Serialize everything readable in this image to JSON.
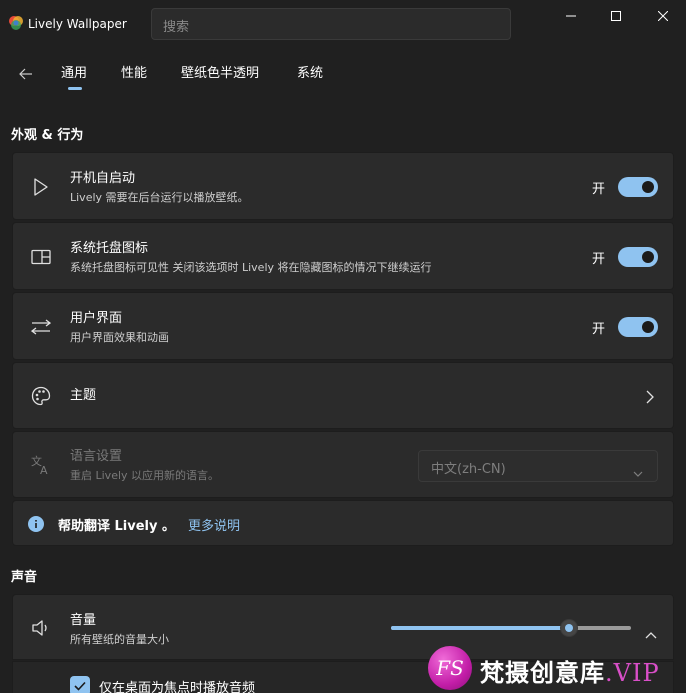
{
  "app": {
    "title": "Lively Wallpaper"
  },
  "search": {
    "placeholder": "搜索"
  },
  "nav": {
    "tabs": [
      {
        "label": "通用"
      },
      {
        "label": "性能"
      },
      {
        "label": "壁纸色半透明"
      },
      {
        "label": "系统"
      }
    ],
    "active_tab": "通用"
  },
  "sections": {
    "appearance": {
      "title": "外观 & 行为",
      "items": [
        {
          "title": "开机自启动",
          "subtitle": "Lively 需要在后台运行以播放壁纸。",
          "toggle_label": "开",
          "state": true,
          "icon": "play-icon"
        },
        {
          "title": "系统托盘图标",
          "subtitle": "系统托盘图标可见性 关闭该选项时 Lively 将在隐藏图标的情况下继续运行",
          "toggle_label": "开",
          "state": true,
          "icon": "tray-icon"
        },
        {
          "title": "用户界面",
          "subtitle": "用户界面效果和动画",
          "toggle_label": "开",
          "state": true,
          "icon": "swap-arrows-icon"
        },
        {
          "title": "主题",
          "icon": "palette-icon"
        },
        {
          "title": "语言设置",
          "subtitle": "重启 Lively 以应用新的语言。",
          "selected": "中文(zh-CN)",
          "icon": "language-icon",
          "disabled": true
        }
      ],
      "info": {
        "text": "帮助翻译 Lively 。",
        "link": "更多说明"
      }
    },
    "sound": {
      "title": "声音",
      "volume": {
        "title": "音量",
        "subtitle": "所有壁纸的音量大小",
        "value": 0.74
      },
      "checkbox": {
        "label": "仅在桌面为焦点时播放音频",
        "checked": true
      }
    }
  },
  "watermark": {
    "badge": "FS",
    "text": "梵摄创意库",
    "suffix": ".VIP"
  },
  "colors": {
    "accent": "#8fc3f0",
    "background": "#202020",
    "card": "#2b2b2b"
  }
}
